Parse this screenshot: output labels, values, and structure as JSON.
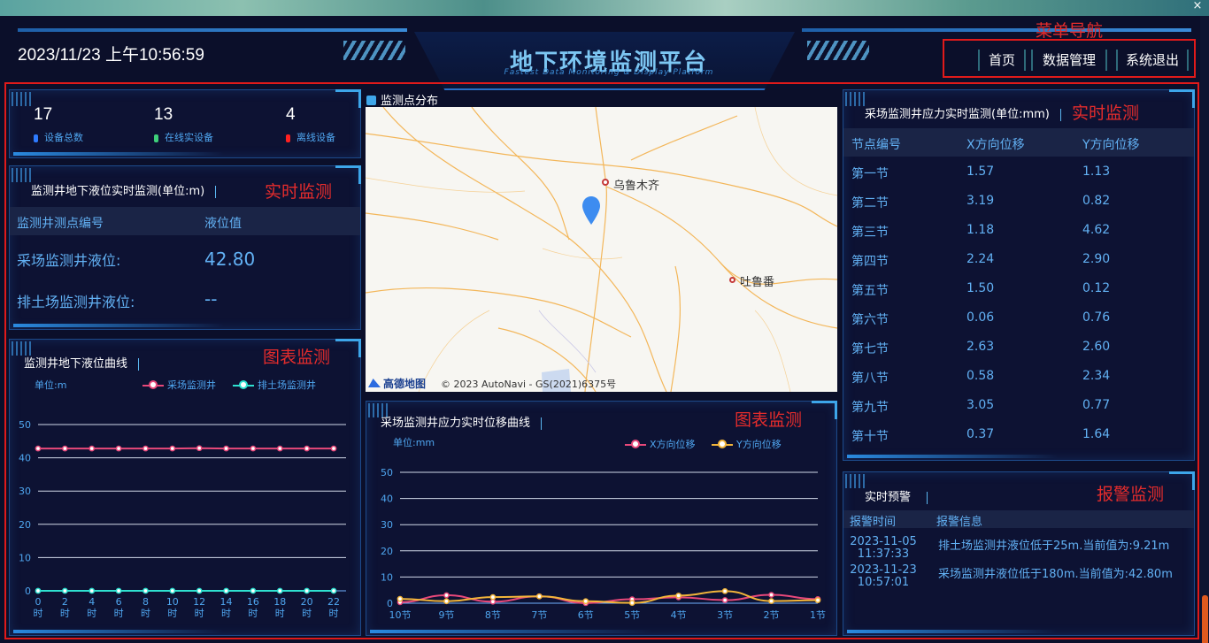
{
  "header": {
    "datetime": "2023/11/23 上午10:56:59",
    "title": "地下环境监测平台",
    "subtitle": "Fastest Data Monitoring & Display Platform",
    "nav": [
      "首页",
      "数据管理",
      "系统退出"
    ],
    "close_glyph": "×"
  },
  "annotations": {
    "menu": "菜单导航",
    "realtime1": "实时监测",
    "realtime2": "实时监测",
    "chart1": "图表监测",
    "chart2": "图表监测",
    "alarm": "报警监测"
  },
  "stats": [
    {
      "value": "17",
      "label": "设备总数",
      "color": "#2e7bff"
    },
    {
      "value": "13",
      "label": "在线实设备",
      "color": "#3ecf7a"
    },
    {
      "value": "4",
      "label": "离线设备",
      "color": "#ff2020"
    }
  ],
  "water": {
    "title": "监测井地下液位实时监测(单位:m)",
    "col1": "监测井测点编号",
    "col2": "液位值",
    "rows": [
      {
        "label": "采场监测井液位:",
        "value": "42.80"
      },
      {
        "label": "排土场监测井液位:",
        "value": "--"
      }
    ]
  },
  "map": {
    "title": "监测点分布",
    "city1": "乌鲁木齐",
    "city2": "吐鲁番",
    "logo": "高德地图",
    "copyright": "© 2023 AutoNavi - GS(2021)6375号"
  },
  "water_chart": {
    "title": "监测井地下液位曲线",
    "unit": "单位:m",
    "legend": [
      "采场监测井",
      "排土场监测井"
    ],
    "colors": [
      "#e8487a",
      "#2ee0d0"
    ]
  },
  "stress_chart": {
    "title": "采场监测井应力实时位移曲线",
    "unit": "单位:mm",
    "legend": [
      "X方向位移",
      "Y方向位移"
    ],
    "colors": [
      "#e8487a",
      "#f2b53a"
    ]
  },
  "stress_table": {
    "title": "采场监测井应力实时监测(单位:mm)",
    "headers": [
      "节点编号",
      "X方向位移",
      "Y方向位移"
    ],
    "rows": [
      [
        "第一节",
        "1.57",
        "1.13"
      ],
      [
        "第二节",
        "3.19",
        "0.82"
      ],
      [
        "第三节",
        "1.18",
        "4.62"
      ],
      [
        "第四节",
        "2.24",
        "2.90"
      ],
      [
        "第五节",
        "1.50",
        "0.12"
      ],
      [
        "第六节",
        "0.06",
        "0.76"
      ],
      [
        "第七节",
        "2.63",
        "2.60"
      ],
      [
        "第八节",
        "0.58",
        "2.34"
      ],
      [
        "第九节",
        "3.05",
        "0.77"
      ],
      [
        "第十节",
        "0.37",
        "1.64"
      ]
    ]
  },
  "alarm": {
    "title": "实时预警",
    "headers": [
      "报警时间",
      "报警信息"
    ],
    "rows": [
      {
        "date": "2023-11-05",
        "time": "11:37:33",
        "msg": "排土场监测井液位低于25m.当前值为:9.21m"
      },
      {
        "date": "2023-11-23",
        "time": "10:57:01",
        "msg": "采场监测井液位低于180m.当前值为:42.80m"
      }
    ]
  },
  "chart_data": [
    {
      "type": "line",
      "ylabel": "单位:m",
      "ylim": [
        0,
        50
      ],
      "yticks": [
        "0",
        "10",
        "20",
        "30",
        "40",
        "50"
      ],
      "x": [
        "0",
        "2",
        "4",
        "6",
        "8",
        "10",
        "12",
        "14",
        "16",
        "18",
        "20",
        "22"
      ],
      "xsuffix": "时",
      "series": [
        {
          "name": "采场监测井",
          "values": [
            42.8,
            42.8,
            42.8,
            42.8,
            42.8,
            42.8,
            42.9,
            42.8,
            42.8,
            42.8,
            42.8,
            42.8
          ]
        },
        {
          "name": "排土场监测井",
          "values": [
            0,
            0,
            0,
            0,
            0,
            0,
            0,
            0,
            0,
            0,
            0,
            0
          ]
        }
      ],
      "legend_position": "top-right",
      "grid": true
    },
    {
      "type": "line",
      "ylabel": "单位:mm",
      "ylim": [
        0,
        50
      ],
      "yticks": [
        "0",
        "10",
        "20",
        "30",
        "40",
        "50"
      ],
      "x": [
        "10节",
        "9节",
        "8节",
        "7节",
        "6节",
        "5节",
        "4节",
        "3节",
        "2节",
        "1节"
      ],
      "series": [
        {
          "name": "X方向位移",
          "values": [
            0.37,
            3.05,
            0.58,
            2.63,
            0.06,
            1.5,
            2.24,
            1.18,
            3.19,
            1.57
          ]
        },
        {
          "name": "Y方向位移",
          "values": [
            1.64,
            0.77,
            2.34,
            2.6,
            0.76,
            0.12,
            2.9,
            4.62,
            0.82,
            1.13
          ]
        }
      ],
      "legend_position": "top-right",
      "grid": true
    }
  ]
}
